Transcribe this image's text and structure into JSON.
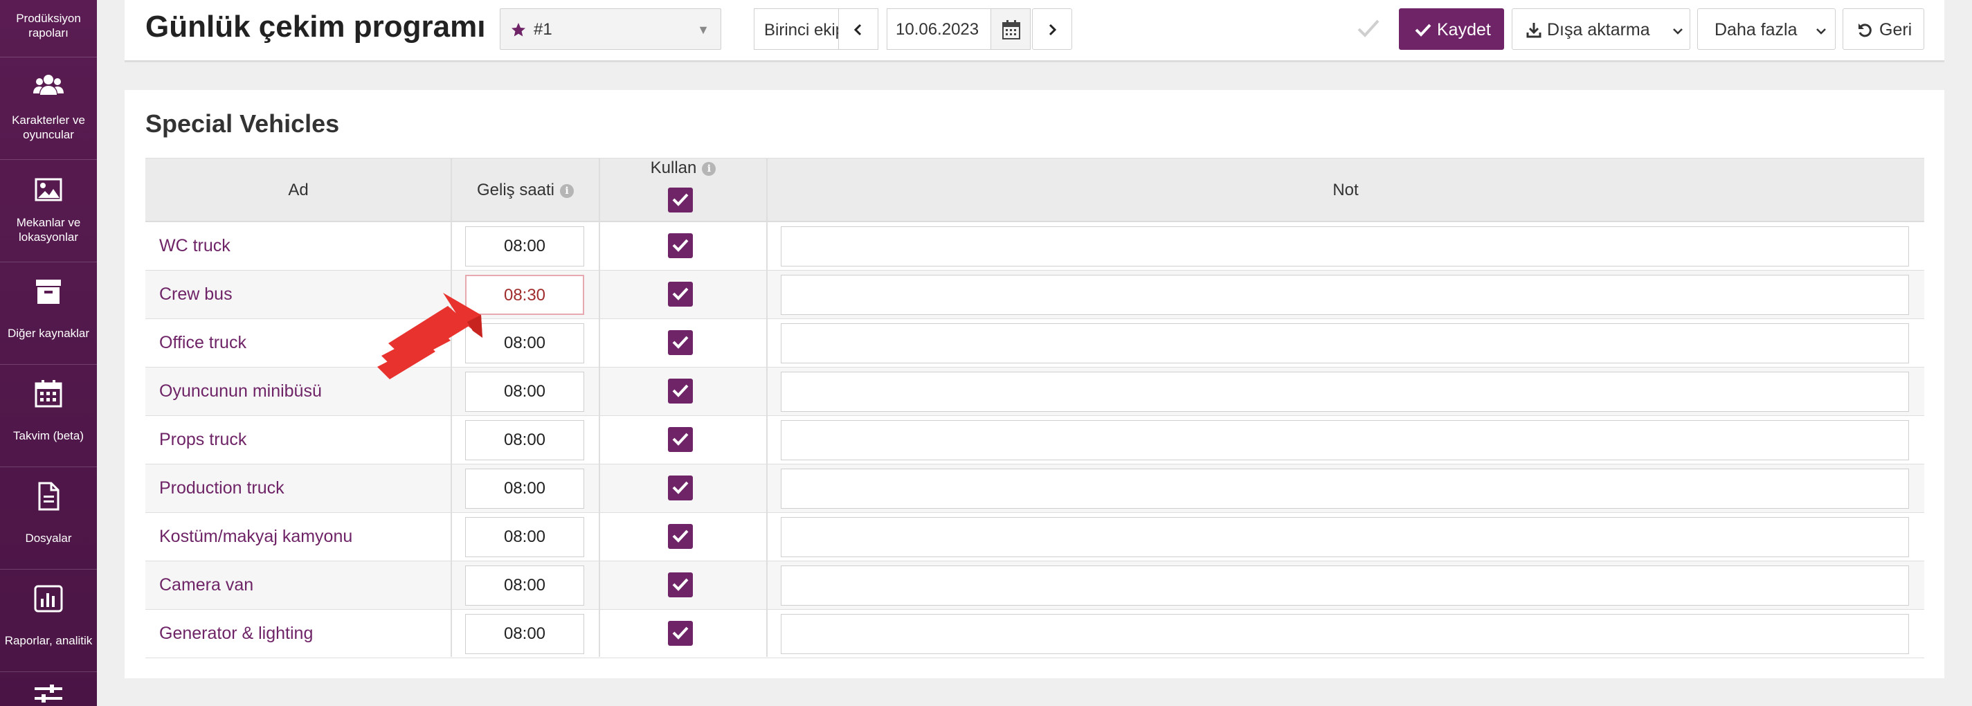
{
  "sidebar": {
    "items": [
      {
        "label": "Prodüksiyon rapoları",
        "icon": "report-icon"
      },
      {
        "label": "Karakterler ve oyuncular",
        "icon": "users-icon"
      },
      {
        "label": "Mekanlar ve lokasyonlar",
        "icon": "image-icon"
      },
      {
        "label": "Diğer kaynaklar",
        "icon": "archive-box-icon"
      },
      {
        "label": "Takvim (beta)",
        "icon": "calendar-icon"
      },
      {
        "label": "Dosyalar",
        "icon": "document-icon"
      },
      {
        "label": "Raporlar, analitik",
        "icon": "bar-chart-icon"
      },
      {
        "label": "",
        "icon": "sliders-icon"
      }
    ]
  },
  "header": {
    "title": "Günlük çekim programı",
    "favorite_select": {
      "value": "#1"
    },
    "team": "Birinci ekip",
    "date": "10.06.2023",
    "save_label": "Kaydet",
    "export_label": "Dışa aktarma",
    "more_label": "Daha fazla",
    "back_label": "Geri"
  },
  "panel": {
    "title": "Special Vehicles",
    "columns": {
      "name": "Ad",
      "arrival": "Geliş saati",
      "use": "Kullan",
      "note": "Not"
    },
    "rows": [
      {
        "name": "WC truck",
        "time": "08:00",
        "used": true,
        "note": ""
      },
      {
        "name": "Crew bus",
        "time": "08:30",
        "used": true,
        "note": "",
        "highlight": true
      },
      {
        "name": "Office truck",
        "time": "08:00",
        "used": true,
        "note": ""
      },
      {
        "name": "Oyuncunun minibüsü",
        "time": "08:00",
        "used": true,
        "note": ""
      },
      {
        "name": "Props truck",
        "time": "08:00",
        "used": true,
        "note": ""
      },
      {
        "name": "Production truck",
        "time": "08:00",
        "used": true,
        "note": ""
      },
      {
        "name": "Kostüm/makyaj kamyonu",
        "time": "08:00",
        "used": true,
        "note": ""
      },
      {
        "name": "Camera van",
        "time": "08:00",
        "used": true,
        "note": ""
      },
      {
        "name": "Generator & lighting",
        "time": "08:00",
        "used": true,
        "note": ""
      }
    ]
  },
  "colors": {
    "brand": "#6e2466",
    "sidebar": "#5a1c52",
    "annotation_arrow": "#e8322e"
  }
}
